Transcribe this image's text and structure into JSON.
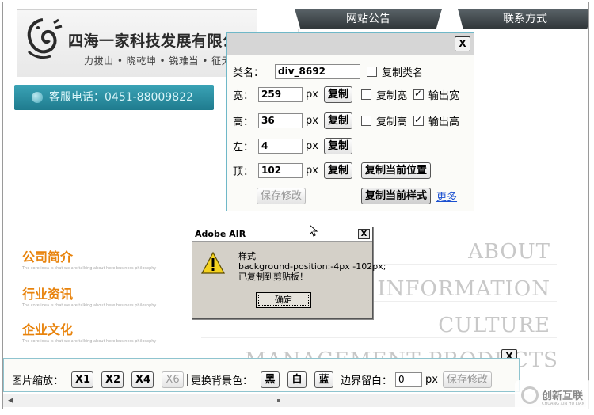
{
  "site": {
    "company_name": "四海一家科技发展有限公司",
    "slogan": "力拔山 • 晓乾坤 • 锐难当 • 征无",
    "hotline": "客服电话：0451-88009822",
    "tabs": [
      "网站公告",
      "联系方式"
    ],
    "categories": [
      {
        "title": "公司简介",
        "sub": "The core idea is that we are talking about here business philosophy",
        "en": "ABOUT"
      },
      {
        "title": "行业资讯",
        "sub": "The core idea is that we are talking about here business philosophy",
        "en": "TRY INFORMATION"
      },
      {
        "title": "企业文化",
        "sub": "The core idea is that we are talking about here business philosophy",
        "en": "CULTURE"
      },
      {
        "title": "",
        "sub": "",
        "en": "MANAGEMENT PRODUCTS"
      }
    ]
  },
  "props_dialog": {
    "close": "X",
    "class_label": "类名：",
    "class_value": "div_8692",
    "copy_class": "复制类名",
    "width_label": "宽：",
    "width_value": "259",
    "height_label": "高：",
    "height_value": "36",
    "left_label": "左：",
    "left_value": "4",
    "top_label": "顶：",
    "top_value": "102",
    "px": "px",
    "copy": "复制",
    "copy_width": "复制宽",
    "output_width": "输出宽",
    "copy_height": "复制高",
    "output_height": "输出高",
    "copy_position": "复制当前位置",
    "save": "保存修改",
    "copy_style": "复制当前样式",
    "more": "更多"
  },
  "air_dialog": {
    "title": "Adobe AIR",
    "close": "X",
    "msg1": "样式",
    "msg2": "background-position:-4px -102px;",
    "msg3": "已复制到剪贴板！",
    "ok": "确定"
  },
  "toolbar": {
    "close": "X",
    "zoom_label": "图片缩放：",
    "zoom": [
      "X1",
      "X2",
      "X4",
      "X6"
    ],
    "bg_label": "更换背景色：",
    "colors": [
      "黑",
      "白",
      "蓝"
    ],
    "margin_label": "边界留白：",
    "margin_value": "0",
    "px": "px",
    "save": "保存修改"
  },
  "watermark": {
    "cn": "创新互联",
    "pinyin": "CHUANG XIN HU LIAN"
  },
  "colors": {
    "accent_orange": "#e8830c",
    "hotline_teal": "#1f7b8e",
    "link_blue": "#1a4fd0"
  }
}
